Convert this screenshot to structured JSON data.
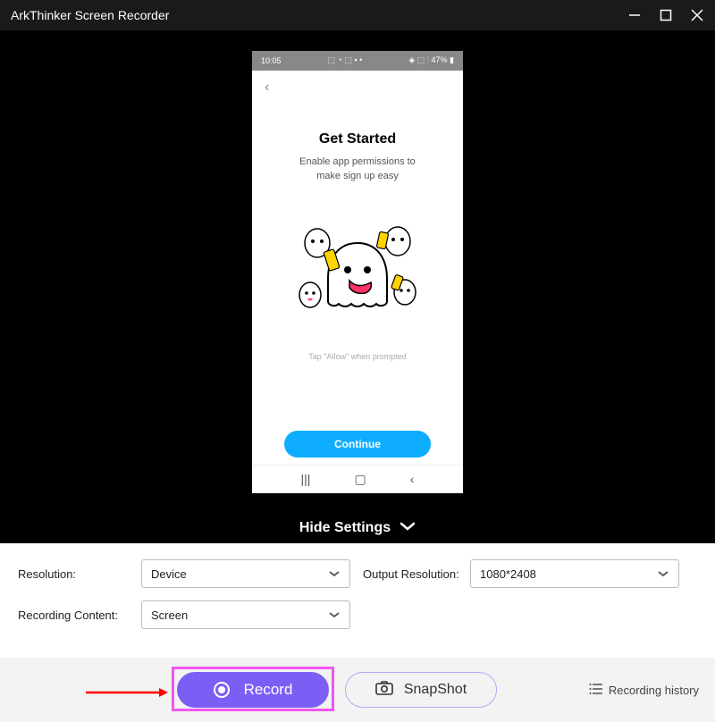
{
  "titlebar": {
    "title": "ArkThinker Screen Recorder"
  },
  "phone": {
    "status_time": "10:05",
    "status_right": "47%",
    "get_started": "Get Started",
    "subtitle_line1": "Enable app permissions to",
    "subtitle_line2": "make sign up easy",
    "prompt": "Tap \"Allow\" when prompted",
    "continue": "Continue"
  },
  "hide_settings_label": "Hide Settings",
  "settings": {
    "resolution_label": "Resolution:",
    "resolution_value": "Device",
    "output_label": "Output Resolution:",
    "output_value": "1080*2408",
    "content_label": "Recording Content:",
    "content_value": "Screen"
  },
  "actions": {
    "record": "Record",
    "snapshot": "SnapShot",
    "history": "Recording history"
  }
}
